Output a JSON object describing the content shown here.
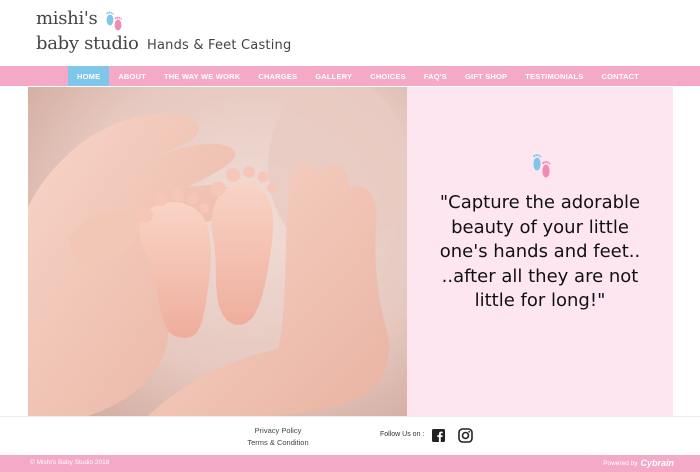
{
  "header": {
    "logo_line1": "mishi's",
    "logo_line2": "baby studio",
    "tagline": "Hands & Feet Casting"
  },
  "nav": {
    "items": [
      {
        "label": "HOME",
        "active": true
      },
      {
        "label": "ABOUT"
      },
      {
        "label": "THE WAY WE WORK"
      },
      {
        "label": "CHARGES"
      },
      {
        "label": "GALLERY"
      },
      {
        "label": "CHOICES"
      },
      {
        "label": "FAQ'S"
      },
      {
        "label": "GIFT SHOP"
      },
      {
        "label": "TESTIMONIALS"
      },
      {
        "label": "CONTACT"
      }
    ]
  },
  "hero": {
    "quote": "\"Capture the adorable beauty of your little one's hands and feet.. ..after all they are not little for long!\""
  },
  "footer": {
    "privacy": "Privacy Policy",
    "terms": "Terms & Condition",
    "follow": "Follow Us on :",
    "copyright": "© Mishi's Baby Studio 2018",
    "powered_by": "Powered by",
    "powered_brand": "Cybrain"
  },
  "colors": {
    "nav_pink": "#f4a9c6",
    "active_blue": "#7fc7ea",
    "panel_pink": "#fde6f0",
    "foot_blue": "#7fc7ea",
    "foot_pink": "#f18bb3"
  },
  "icons": [
    "baby-feet-icon",
    "facebook-icon",
    "instagram-icon"
  ]
}
